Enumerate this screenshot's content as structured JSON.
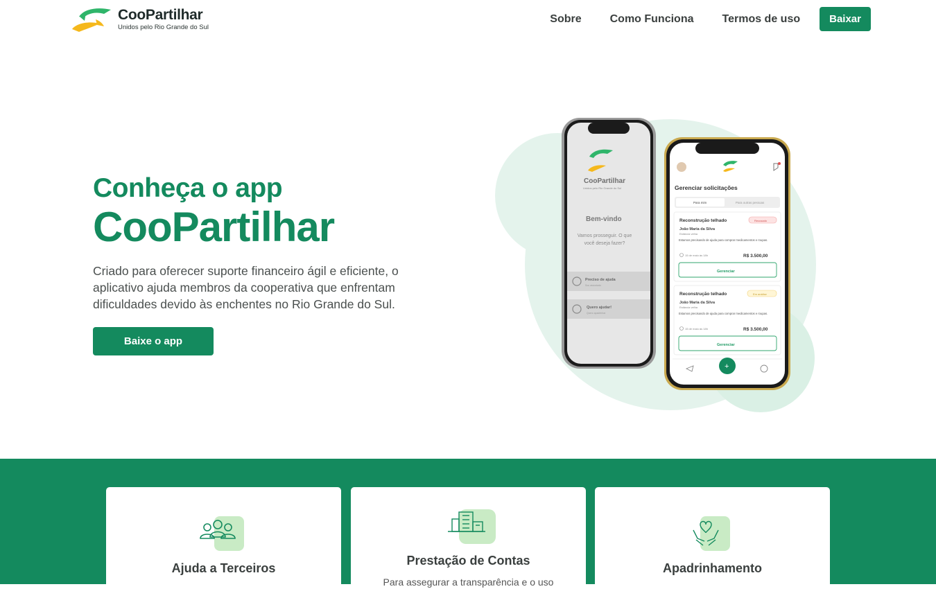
{
  "header": {
    "logo_title": "CooPartilhar",
    "logo_subtitle": "Unidos pelo Rio Grande do Sul",
    "nav": [
      {
        "label": "Sobre"
      },
      {
        "label": "Como Funciona"
      },
      {
        "label": "Termos de uso"
      }
    ],
    "cta_label": "Baixar"
  },
  "hero": {
    "title_line1": "Conheça o app",
    "title_line2": "CooPartilhar",
    "description": "Criado para oferecer suporte financeiro ágil e eficiente, o aplicativo ajuda membros da cooperativa que enfrentam dificuldades devido às enchentes no Rio Grande do Sul.",
    "button_label": "Baixe o app"
  },
  "phone_left": {
    "app_name": "CooPartilhar",
    "app_tagline": "Unidos pelo Rio Grande do Sul",
    "welcome": "Bem-vindo",
    "question": "Vamos prosseguir. O que você deseja fazer?",
    "option1": "Preciso de ajuda",
    "option1_sub": "Sou associado",
    "option2": "Quero ajudar!",
    "option2_sub": "Quero apadrinhar"
  },
  "phone_right": {
    "screen_title": "Gerenciar solicitações",
    "tab_active": "Para mim",
    "tab_inactive": "Para outras pessoas",
    "requests": [
      {
        "title": "Reconstrução telhado",
        "badge": "Recusado",
        "name": "João Maria da Silva",
        "place": "Estância velha",
        "desc": "Estamos precisando de ajuda para comprar medicamentos e roupas.",
        "date": "15 de maio às 18h",
        "amount": "R$ 3.500,00",
        "action": "Gerenciar"
      },
      {
        "title": "Reconstrução telhado",
        "badge": "Em análise",
        "name": "João Maria da Silva",
        "place": "Estância velha",
        "desc": "Estamos precisando de ajuda para comprar medicamentos e roupas.",
        "date": "15 de maio às 18h",
        "amount": "R$ 3.500,00",
        "action": "Gerenciar"
      }
    ]
  },
  "features": [
    {
      "title": "Ajuda a Terceiros",
      "icon": "people-icon",
      "text": ""
    },
    {
      "title": "Prestação de Contas",
      "icon": "buildings-icon",
      "text": "Para assegurar a transparência e o uso"
    },
    {
      "title": "Apadrinhamento",
      "icon": "hands-heart-icon",
      "text": ""
    }
  ],
  "colors": {
    "brand_green": "#148a5e",
    "light_green": "#c9ebc5",
    "logo_yellow": "#f5b81c",
    "logo_green": "#2fb56a"
  }
}
